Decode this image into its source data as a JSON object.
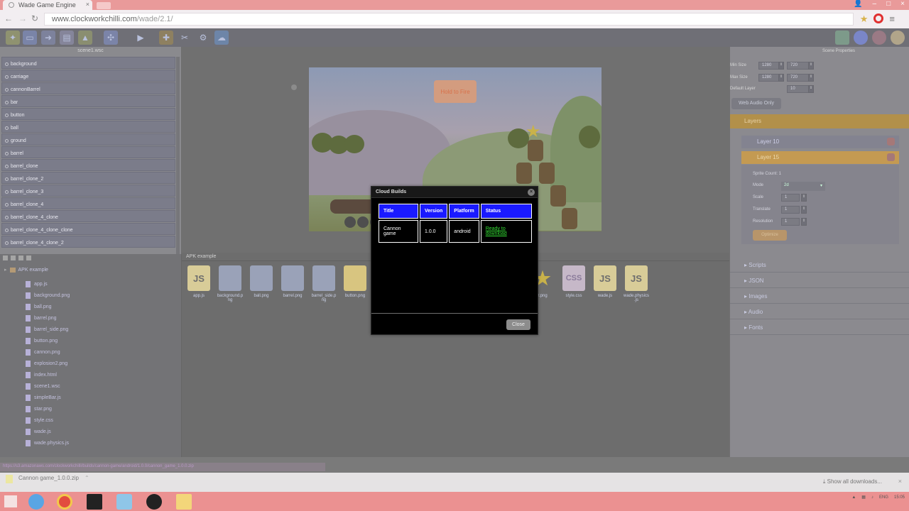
{
  "browser": {
    "tab_title": "Wade Game Engine",
    "url_host": "www.clockworkchilli.com",
    "url_path": "/wade/2.1/"
  },
  "scene_panel": {
    "title": "scene1.wsc",
    "objects": [
      "background",
      "carriage",
      "cannonBarrel",
      "bar",
      "button",
      "ball",
      "ground",
      "barrel",
      "barrel_clone",
      "barrel_clone_2",
      "barrel_clone_3",
      "barrel_clone_4",
      "barrel_clone_4_clone",
      "barrel_clone_4_clone_clone",
      "barrel_clone_4_clone_2"
    ]
  },
  "file_tree": {
    "root": "APK example",
    "files": [
      "app.js",
      "background.png",
      "ball.png",
      "barrel.png",
      "barrel_side.png",
      "button.png",
      "cannon.png",
      "explosion2.png",
      "index.html",
      "scene1.wsc",
      "simpleBar.js",
      "star.png",
      "style.css",
      "wade.js",
      "wade.physics.js"
    ]
  },
  "canvas": {
    "hold_button": "Hold to Fire"
  },
  "assets_panel": {
    "title": "APK example",
    "assets": [
      {
        "name": "app.js",
        "kind": "js"
      },
      {
        "name": "background.p ng",
        "kind": "img"
      },
      {
        "name": "ball.png",
        "kind": "img"
      },
      {
        "name": "barrel.png",
        "kind": "img"
      },
      {
        "name": "barrel_side.p ng",
        "kind": "img"
      },
      {
        "name": "button.png",
        "kind": "img"
      },
      {
        "name": "r.png",
        "kind": "img"
      },
      {
        "name": "style.css",
        "kind": "css"
      },
      {
        "name": "wade.js",
        "kind": "js"
      },
      {
        "name": "wade.physics .js",
        "kind": "js"
      }
    ]
  },
  "scene_properties": {
    "title": "Scene Properties",
    "min_size_label": "Min Size",
    "min_w": "1280",
    "min_h": "720",
    "max_size_label": "Max Size",
    "max_w": "1280",
    "max_h": "720",
    "default_layer_label": "Default Layer",
    "default_layer": "10",
    "web_audio_only": "Web Audio Only",
    "layers_label": "Layers",
    "layer_10": "Layer 10",
    "layer_15": "Layer 15",
    "sprite_count": "Sprite Count: 1",
    "mode_label": "Mode",
    "mode_value": "2d",
    "scale_label": "Scale",
    "scale_value": "1",
    "translate_label": "Translate",
    "translate_value": "1",
    "resolution_label": "Resolution",
    "resolution_value": "1",
    "optimize": "Optimize",
    "sections": [
      "Scripts",
      "JSON",
      "Images",
      "Audio",
      "Fonts"
    ]
  },
  "modal": {
    "title": "Cloud Builds",
    "columns": [
      "Title",
      "Version",
      "Platform",
      "Status"
    ],
    "row": {
      "title": "Cannon game",
      "version": "1.0.0",
      "platform": "android",
      "status": "Ready to download"
    },
    "close_button": "Close"
  },
  "downloads": {
    "file": "Cannon game_1.0.0.zip",
    "show_all": "Show all downloads..."
  },
  "colors": {
    "modal_header_cell": "#1a1aff",
    "ready_link": "#34e234",
    "layers_accent": "#b2904a"
  }
}
